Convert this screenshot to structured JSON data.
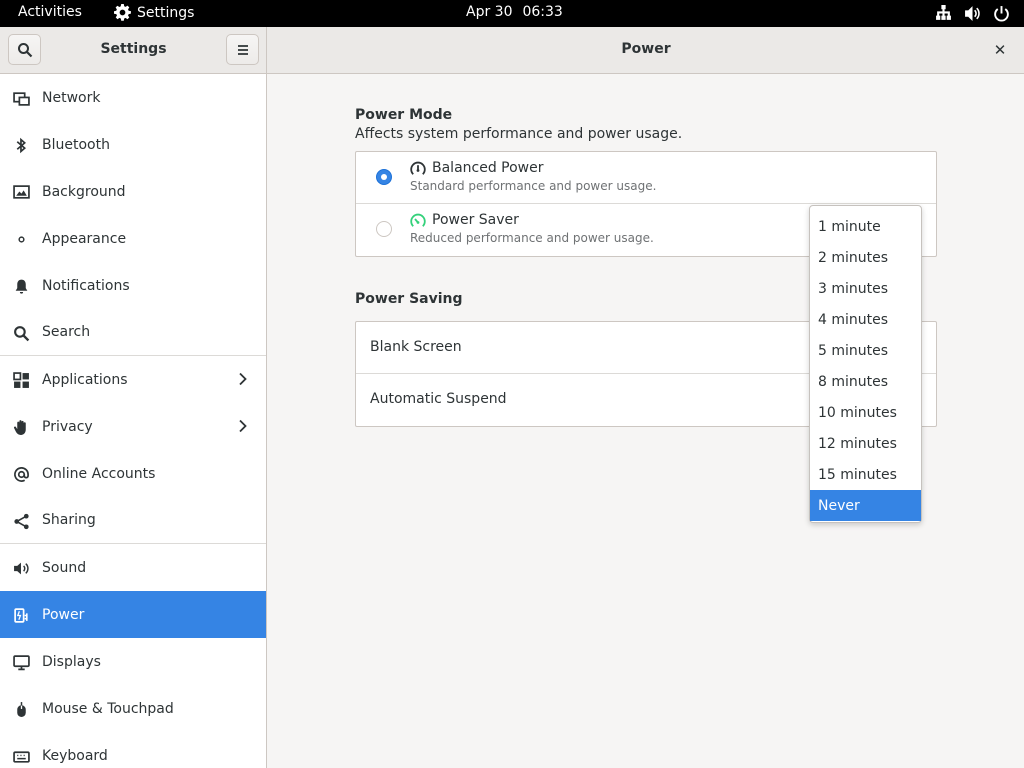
{
  "topbar": {
    "activities": "Activities",
    "app_name": "Settings",
    "date": "Apr 30",
    "time": "06:33"
  },
  "header": {
    "sidebar_title": "Settings",
    "page_title": "Power"
  },
  "sidebar": {
    "items": [
      {
        "label": "Network",
        "icon": "network-icon"
      },
      {
        "label": "Bluetooth",
        "icon": "bluetooth-icon"
      },
      {
        "label": "Background",
        "icon": "background-icon"
      },
      {
        "label": "Appearance",
        "icon": "appearance-icon"
      },
      {
        "label": "Notifications",
        "icon": "bell-icon"
      },
      {
        "label": "Search",
        "icon": "search-icon"
      },
      {
        "label": "Applications",
        "icon": "applications-icon"
      },
      {
        "label": "Privacy",
        "icon": "hand-icon"
      },
      {
        "label": "Online Accounts",
        "icon": "at-icon"
      },
      {
        "label": "Sharing",
        "icon": "share-icon"
      },
      {
        "label": "Sound",
        "icon": "speaker-icon"
      },
      {
        "label": "Power",
        "icon": "power-plug-icon"
      },
      {
        "label": "Displays",
        "icon": "display-icon"
      },
      {
        "label": "Mouse & Touchpad",
        "icon": "mouse-icon"
      },
      {
        "label": "Keyboard",
        "icon": "keyboard-icon"
      }
    ],
    "active": "Power"
  },
  "power_mode": {
    "title": "Power Mode",
    "subtitle": "Affects system performance and power usage.",
    "options": [
      {
        "label": "Balanced Power",
        "description": "Standard performance and power usage.",
        "checked": true
      },
      {
        "label": "Power Saver",
        "description": "Reduced performance and power usage.",
        "checked": false
      }
    ]
  },
  "power_saving": {
    "title": "Power Saving",
    "rows": [
      {
        "label": "Blank Screen"
      },
      {
        "label": "Automatic Suspend"
      }
    ]
  },
  "blank_screen_dropdown": {
    "options": [
      "1 minute",
      "2 minutes",
      "3 minutes",
      "4 minutes",
      "5 minutes",
      "8 minutes",
      "10 minutes",
      "12 minutes",
      "15 minutes",
      "Never"
    ],
    "selected": "Never"
  },
  "colors": {
    "accent": "#3584e4",
    "topbar": "#000000",
    "saver_icon": "#33d17a"
  }
}
